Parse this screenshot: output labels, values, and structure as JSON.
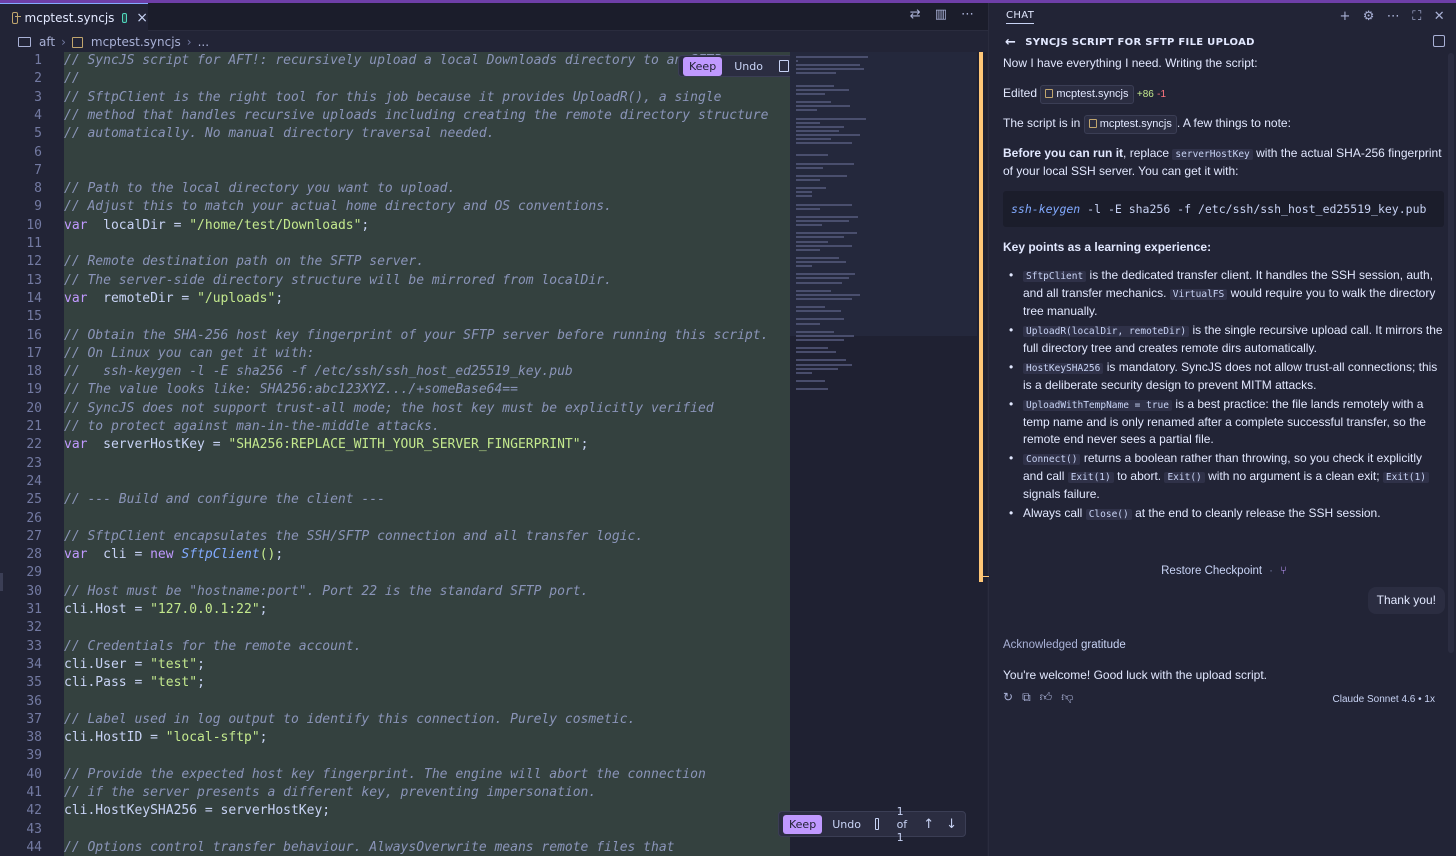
{
  "editor": {
    "tab": {
      "filename": "mcptest.syncjs",
      "close": "×"
    },
    "tab_actions": [
      "⇄",
      "▥",
      "⋯"
    ],
    "breadcrumb": {
      "folder": "aft",
      "sep": "›",
      "file": "mcptest.syncjs",
      "sep2": "›",
      "more": "..."
    },
    "inline_review": {
      "keep": "Keep",
      "undo": "Undo"
    },
    "bottom_review": {
      "keep": "Keep",
      "undo": "Undo",
      "count": "1 of 1",
      "up": "↑",
      "down": "↓"
    },
    "lines": [
      [
        [
          "cm",
          "// SyncJS script for AFT!: recursively upload a local Downloads directory to an SFTP server."
        ]
      ],
      [
        [
          "cm",
          "//"
        ]
      ],
      [
        [
          "cm",
          "// SftpClient is the right tool for this job because it provides UploadR(), a single"
        ]
      ],
      [
        [
          "cm",
          "// method that handles recursive uploads including creating the remote directory structure"
        ]
      ],
      [
        [
          "cm",
          "// automatically. No manual directory traversal needed."
        ]
      ],
      [],
      [],
      [
        [
          "cm",
          "// Path to the local directory you want to upload."
        ]
      ],
      [
        [
          "cm",
          "// Adjust this to match your actual home directory and OS conventions."
        ]
      ],
      [
        [
          "kw",
          "var"
        ],
        [
          "",
          "  localDir = "
        ],
        [
          "str",
          "\"/home/test/Downloads\""
        ],
        [
          "",
          ";"
        ]
      ],
      [],
      [
        [
          "cm",
          "// Remote destination path on the SFTP server."
        ]
      ],
      [
        [
          "cm",
          "// The server-side directory structure will be mirrored from localDir."
        ]
      ],
      [
        [
          "kw",
          "var"
        ],
        [
          "",
          "  remoteDir = "
        ],
        [
          "str",
          "\"/uploads\""
        ],
        [
          "",
          ";"
        ]
      ],
      [],
      [
        [
          "cm",
          "// Obtain the SHA-256 host key fingerprint of your SFTP server before running this script."
        ]
      ],
      [
        [
          "cm",
          "// On Linux you can get it with:"
        ]
      ],
      [
        [
          "cm",
          "//   ssh-keygen -l -E sha256 -f /etc/ssh/ssh_host_ed25519_key.pub"
        ]
      ],
      [
        [
          "cm",
          "// The value looks like: SHA256:abc123XYZ.../+someBase64=="
        ]
      ],
      [
        [
          "cm",
          "// SyncJS does not support trust-all mode; the host key must be explicitly verified"
        ]
      ],
      [
        [
          "cm",
          "// to protect against man-in-the-middle attacks."
        ]
      ],
      [
        [
          "kw",
          "var"
        ],
        [
          "",
          "  serverHostKey = "
        ],
        [
          "str",
          "\"SHA256:REPLACE_WITH_YOUR_SERVER_FINGERPRINT\""
        ],
        [
          "",
          ";"
        ]
      ],
      [],
      [],
      [
        [
          "cm",
          "// --- Build and configure the client ---"
        ]
      ],
      [],
      [
        [
          "cm",
          "// SftpClient encapsulates the SSH/SFTP connection and all transfer logic."
        ]
      ],
      [
        [
          "kw",
          "var"
        ],
        [
          "",
          "  cli = "
        ],
        [
          "kw",
          "new"
        ],
        [
          "",
          " "
        ],
        [
          "fn",
          "SftpClient"
        ],
        [
          "cur",
          "()"
        ],
        [
          "",
          ";"
        ]
      ],
      [],
      [
        [
          "cm",
          "// Host must be \"hostname:port\". Port 22 is the standard SFTP port."
        ]
      ],
      [
        [
          "",
          "cli.Host = "
        ],
        [
          "str",
          "\"127.0.0.1:22\""
        ],
        [
          "",
          ";"
        ]
      ],
      [],
      [
        [
          "cm",
          "// Credentials for the remote account."
        ]
      ],
      [
        [
          "",
          "cli.User = "
        ],
        [
          "str",
          "\"test\""
        ],
        [
          "",
          ";"
        ]
      ],
      [
        [
          "",
          "cli.Pass = "
        ],
        [
          "str",
          "\"test\""
        ],
        [
          "",
          ";"
        ]
      ],
      [],
      [
        [
          "cm",
          "// Label used in log output to identify this connection. Purely cosmetic."
        ]
      ],
      [
        [
          "",
          "cli.HostID = "
        ],
        [
          "str",
          "\"local-sftp\""
        ],
        [
          "",
          ";"
        ]
      ],
      [],
      [
        [
          "cm",
          "// Provide the expected host key fingerprint. The engine will abort the connection"
        ]
      ],
      [
        [
          "cm",
          "// if the server presents a different key, preventing impersonation."
        ]
      ],
      [
        [
          "",
          "cli.HostKeySHA256 = serverHostKey;"
        ]
      ],
      [],
      [
        [
          "cm",
          "// Options control transfer behaviour. AlwaysOverwrite means remote files that"
        ]
      ]
    ]
  },
  "chat": {
    "header": "CHAT",
    "header_actions": [
      "+",
      "⚙",
      "⋯",
      "⛶",
      "✕"
    ],
    "title": "SYNCJS SCRIPT FOR SFTP FILE UPLOAD",
    "intro": "Now I have everything I need. Writing the script:",
    "edited_label": "Edited",
    "edited_file": "mcptest.syncjs",
    "edited_add": "+86",
    "edited_del": "-1",
    "script_in_pre": "The script is in",
    "script_in_file": "mcptest.syncjs",
    "script_in_post": ". A few things to note:",
    "before_bold": "Before you can run it",
    "before_mid": ", replace",
    "before_code": "serverHostKey",
    "before_post": "with the actual SHA-256 fingerprint of your local SSH server. You can get it with:",
    "cmd_bin": "ssh-keygen",
    "cmd_args": " -l -E sha256 -f /etc/ssh/ssh_host_ed25519_key.pub",
    "key_points": "Key points as a learning experience:",
    "bullets": [
      {
        "code": "SftpClient",
        "text": " is the dedicated transfer client. It handles the SSH session, auth, and all transfer mechanics. ",
        "code2": "VirtualFS",
        "text2": " would require you to walk the directory tree manually."
      },
      {
        "code": "UploadR(localDir, remoteDir)",
        "text": " is the single recursive upload call. It mirrors the full directory tree and creates remote dirs automatically.",
        "code2": "",
        "text2": ""
      },
      {
        "code": "HostKeySHA256",
        "text": " is mandatory. SyncJS does not allow trust-all connections; this is a deliberate security design to prevent MITM attacks.",
        "code2": "",
        "text2": ""
      },
      {
        "code": "UploadWithTempName = true",
        "text": " is a best practice: the file lands remotely with a temp name and is only renamed after a complete successful transfer, so the remote end never sees a partial file.",
        "code2": "",
        "text2": ""
      },
      {
        "code": "Connect()",
        "text": " returns a boolean rather than throwing, so you check it explicitly and call ",
        "code2": "Exit(1)",
        "text2": " to abort. ",
        "code3": "Exit()",
        "text3": " with no argument is a clean exit; ",
        "code4": "Exit(1)",
        "text4": " signals failure."
      },
      {
        "pre": "Always call ",
        "code": "Close()",
        "text": " at the end to cleanly release the SSH session.",
        "code2": "",
        "text2": ""
      }
    ],
    "restore": "Restore Checkpoint",
    "user_msg": "Thank you!",
    "ack_pre": "Acknowledged",
    "ack_word": "gratitude",
    "welcome": "You're welcome! Good luck with the upload script.",
    "model": "Claude Sonnet 4.6 • 1x"
  }
}
